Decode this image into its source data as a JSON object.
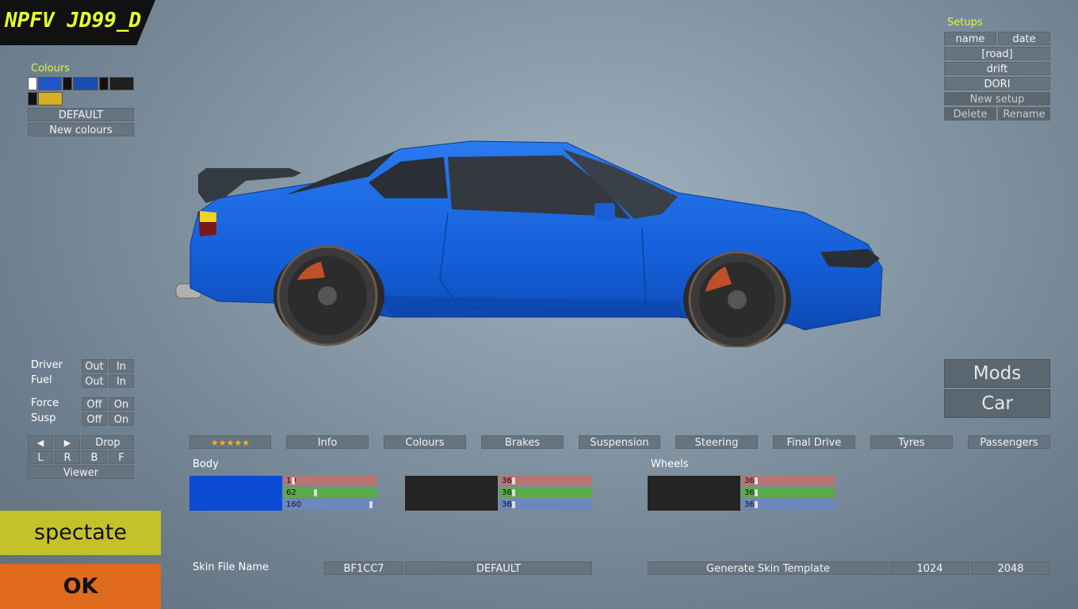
{
  "title": "NPFV JD99_D",
  "colours_panel": {
    "label": "Colours",
    "default_label": "DEFAULT",
    "new_label": "New colours",
    "swatches": [
      "#ffffff",
      "#1e55c8",
      "#111111",
      "#1a4db0",
      "#111111",
      "#1f1f1f",
      "#111111",
      "#d4b022"
    ]
  },
  "setups": {
    "label": "Setups",
    "name_header": "name",
    "date_header": "date",
    "items": [
      "[road]",
      "drift",
      "DORI"
    ],
    "new_label": "New setup",
    "delete_label": "Delete",
    "rename_label": "Rename"
  },
  "toggles": {
    "driver": {
      "label": "Driver",
      "a": "Out",
      "b": "In"
    },
    "fuel": {
      "label": "Fuel",
      "a": "Out",
      "b": "In"
    },
    "force": {
      "label": "Force",
      "a": "Off",
      "b": "On"
    },
    "susp": {
      "label": "Susp",
      "a": "Off",
      "b": "On"
    }
  },
  "viewer": {
    "left": "◀",
    "right": "▶",
    "drop": "Drop",
    "l": "L",
    "r": "R",
    "b": "B",
    "f": "F",
    "label": "Viewer"
  },
  "actions": {
    "spectate": "spectate",
    "ok": "OK",
    "mods": "Mods",
    "car": "Car"
  },
  "tabs": {
    "stars": "★★★★★",
    "info": "Info",
    "colours": "Colours",
    "brakes": "Brakes",
    "suspension": "Suspension",
    "steering": "Steering",
    "final_drive": "Final Drive",
    "tyres": "Tyres",
    "passengers": "Passengers"
  },
  "body": {
    "label": "Body",
    "color1": "#0b4bd4",
    "r1": "10",
    "g1": "62",
    "b1": "160",
    "color2": "#242424",
    "r2": "36",
    "g2": "36",
    "b2": "36"
  },
  "wheels": {
    "label": "Wheels",
    "color": "#242424",
    "r": "36",
    "g": "36",
    "b": "36"
  },
  "skin": {
    "label": "Skin File Name",
    "code": "BF1CC7",
    "name": "DEFAULT",
    "generate": "Generate Skin Template",
    "size1": "1024",
    "size2": "2048"
  },
  "car_colors": {
    "body": "#1a66e0",
    "window": "#2a2f36",
    "wheel": "#3a3a3a",
    "caliper": "#c0502a"
  }
}
